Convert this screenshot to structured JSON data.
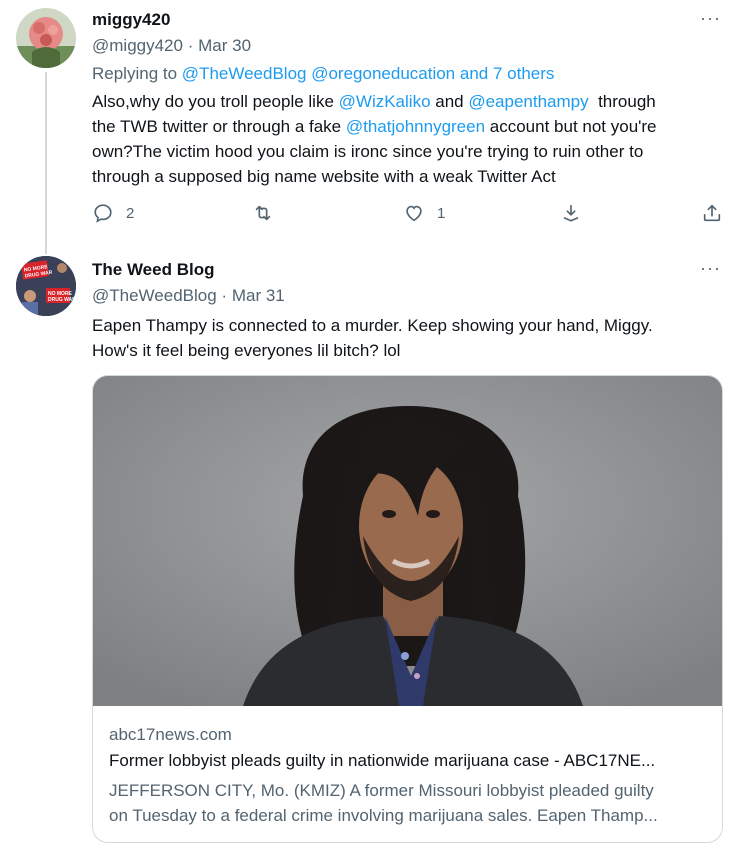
{
  "tweet1": {
    "display_name": "miggy420",
    "handle": "@miggy420",
    "separator": "·",
    "date": "Mar 30",
    "more": "···",
    "replying_prefix": "Replying to",
    "replying_to": [
      "@TheWeedBlog",
      "@oregoneducation",
      "and 7 others"
    ],
    "text": {
      "l1_a": "Also,why do you troll people like ",
      "l1_m1": "@WizKaliko",
      "l1_b": " and ",
      "l1_m2": "@eapenthampy",
      "l1_c": "  through",
      "l2_a": "the TWB twitter or through a fake ",
      "l2_m": "@thatjohnnygreen",
      "l2_b": " account but not you're",
      "l3": "own?The victim hood you claim is ironc since you're trying to ruin other to",
      "l4": "through a supposed big name website with a weak Twitter Act"
    },
    "actions": {
      "reply_count": "2",
      "retweet_count": "",
      "like_count": "1"
    }
  },
  "tweet2": {
    "display_name": "The Weed Blog",
    "handle": "@TheWeedBlog",
    "separator": "·",
    "date": "Mar 31",
    "more": "···",
    "avatar_sign_text": [
      "NO MORE",
      "DRUG WAR"
    ],
    "text": {
      "l1": "Eapen Thampy is connected to a murder. Keep showing your hand, Miggy.",
      "l2": "How's it feel being everyones lil bitch? lol"
    },
    "card": {
      "domain": "abc17news.com",
      "title": "Former lobbyist pleads guilty in nationwide marijuana case - ABC17NE...",
      "desc_l1": "JEFFERSON CITY, Mo. (KMIZ) A former Missouri lobbyist pleaded guilty",
      "desc_l2": "on Tuesday to a federal crime involving marijuana sales. Eapen Thamp..."
    }
  },
  "colors": {
    "link": "#1d9bf0",
    "secondary_text": "#536471",
    "primary_text": "#0f1419",
    "border": "#cfd9de"
  }
}
